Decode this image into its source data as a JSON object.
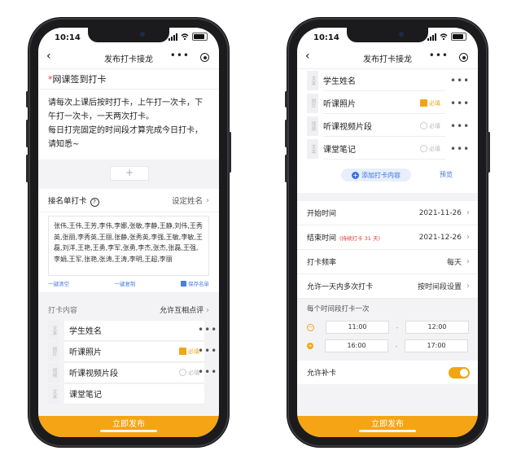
{
  "status": {
    "time": "10:14"
  },
  "nav": {
    "back": "‹",
    "title": "发布打卡接龙",
    "dots": "•••"
  },
  "left": {
    "task_title": "网课签到打卡",
    "required_mark": "*",
    "description": [
      "请每次上课后按时打卡，上午打一次卡，下午打一次卡，一天两次打卡。",
      "每日打完固定的时间段才算完成今日打卡，请知悉~"
    ],
    "add_symbol": "+",
    "roster": {
      "label": "接名单打卡",
      "help": "?",
      "action": "设定姓名"
    },
    "names_text": "张伟,王伟,王芳,李伟,李娜,张敏,李静,王静,刘伟,王秀英,张丽,李秀英,王丽,张静,张秀英,李强,王敏,李敏,王磊,刘洋,王艳,王勇,李军,张勇,李杰,张杰,张磊,王强,李娟,王军,张艳,张涛,王涛,李明,王超,李丽",
    "name_actions": {
      "clear": "一键清空",
      "copy": "一键复制",
      "save": "保存名单"
    },
    "section": {
      "label": "打卡内容",
      "action": "允许互相点评"
    },
    "items": [
      {
        "tag": "文本",
        "label": "学生姓名",
        "flag": ""
      },
      {
        "tag": "图片",
        "label": "听课照片",
        "flag": "必填"
      },
      {
        "tag": "视频",
        "label": "听课视频片段",
        "flag": "必填"
      },
      {
        "tag": "文本",
        "label": "课堂笔记",
        "flag": ""
      }
    ],
    "more": "•••",
    "publish": "立即发布"
  },
  "right": {
    "items": [
      {
        "tag": "文本",
        "label": "学生姓名",
        "flag": ""
      },
      {
        "tag": "图片",
        "label": "听课照片",
        "flag": "必填"
      },
      {
        "tag": "视频",
        "label": "听课视频片段",
        "flag": "必填"
      },
      {
        "tag": "文本",
        "label": "课堂笔记",
        "flag": "必填"
      }
    ],
    "more": "•••",
    "add_content": "添加打卡内容",
    "add_plus": "+",
    "preview": "预览",
    "start": {
      "label": "开始时间",
      "value": "2021-11-26"
    },
    "end": {
      "label": "结束时间",
      "note": "(持续打卡 31 天)",
      "value": "2021-12-26"
    },
    "frequency": {
      "label": "打卡频率",
      "value": "每天"
    },
    "multi": {
      "label": "允许一天内多次打卡",
      "value": "按时间段设置"
    },
    "period_head": "每个时间段打卡一次",
    "periods": [
      {
        "icon": "−",
        "start": "11:00",
        "end": "12:00"
      },
      {
        "icon": "+",
        "start": "16:00",
        "end": "17:00"
      }
    ],
    "dash": "-",
    "makeup": {
      "label": "允许补卡",
      "on": true
    },
    "publish": "立即发布"
  },
  "colors": {
    "accent": "#f4a414",
    "link": "#3d6fd8",
    "required": "#e03b3b"
  }
}
